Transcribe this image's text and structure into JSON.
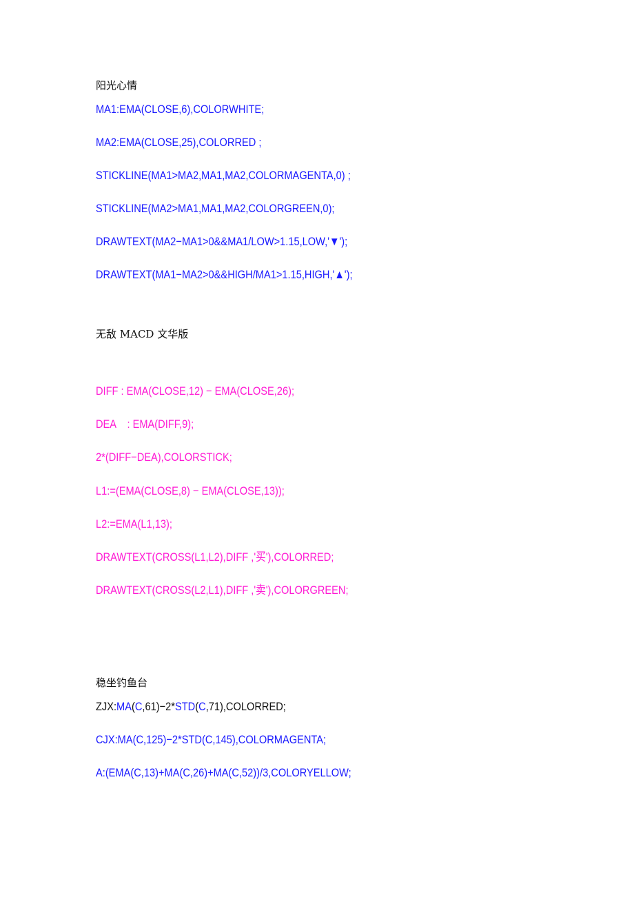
{
  "colors": {
    "blue": "#1a1aff",
    "magenta": "#ff1ad4",
    "black": "#111111"
  },
  "sections": [
    {
      "title": "阳光心情",
      "lines": [
        "MA1:EMA(CLOSE,6),COLORWHITE;",
        "MA2:EMA(CLOSE,25),COLORRED ;",
        "STICKLINE(MA1>MA2,MA1,MA2,COLORMAGENTA,0) ;",
        "STICKLINE(MA2>MA1,MA1,MA2,COLORGREEN,0);",
        "DRAWTEXT(MA2−MA1>0&&MA1/LOW>1.15,LOW,'▼');",
        "DRAWTEXT(MA1−MA2>0&&HIGH/MA1>1.15,HIGH,'▲');"
      ]
    },
    {
      "title": "无敌 MACD 文华版",
      "lines": [
        "DIFF : EMA(CLOSE,12) − EMA(CLOSE,26);",
        "DEA    : EMA(DIFF,9);",
        "2*(DIFF−DEA),COLORSTICK;",
        "L1:=(EMA(CLOSE,8) − EMA(CLOSE,13));",
        "L2:=EMA(L1,13);",
        "DRAWTEXT(CROSS(L1,L2),DIFF ,'买'),COLORRED;",
        "DRAWTEXT(CROSS(L2,L1),DIFF ,'卖'),COLORGREEN;"
      ]
    },
    {
      "title": "稳坐钓鱼台",
      "zjx_segments": [
        {
          "text": "ZJX:",
          "color": "black"
        },
        {
          "text": "MA",
          "color": "blue"
        },
        {
          "text": "(",
          "color": "black"
        },
        {
          "text": "C",
          "color": "blue"
        },
        {
          "text": ",61)−2*",
          "color": "black"
        },
        {
          "text": "STD",
          "color": "blue"
        },
        {
          "text": "(",
          "color": "black"
        },
        {
          "text": "C",
          "color": "blue"
        },
        {
          "text": ",71),COLORRED;",
          "color": "black"
        }
      ],
      "lines": [
        "CJX:MA(C,125)−2*STD(C,145),COLORMAGENTA;",
        "A:(EMA(C,13)+MA(C,26)+MA(C,52))/3,COLORYELLOW;"
      ]
    }
  ]
}
